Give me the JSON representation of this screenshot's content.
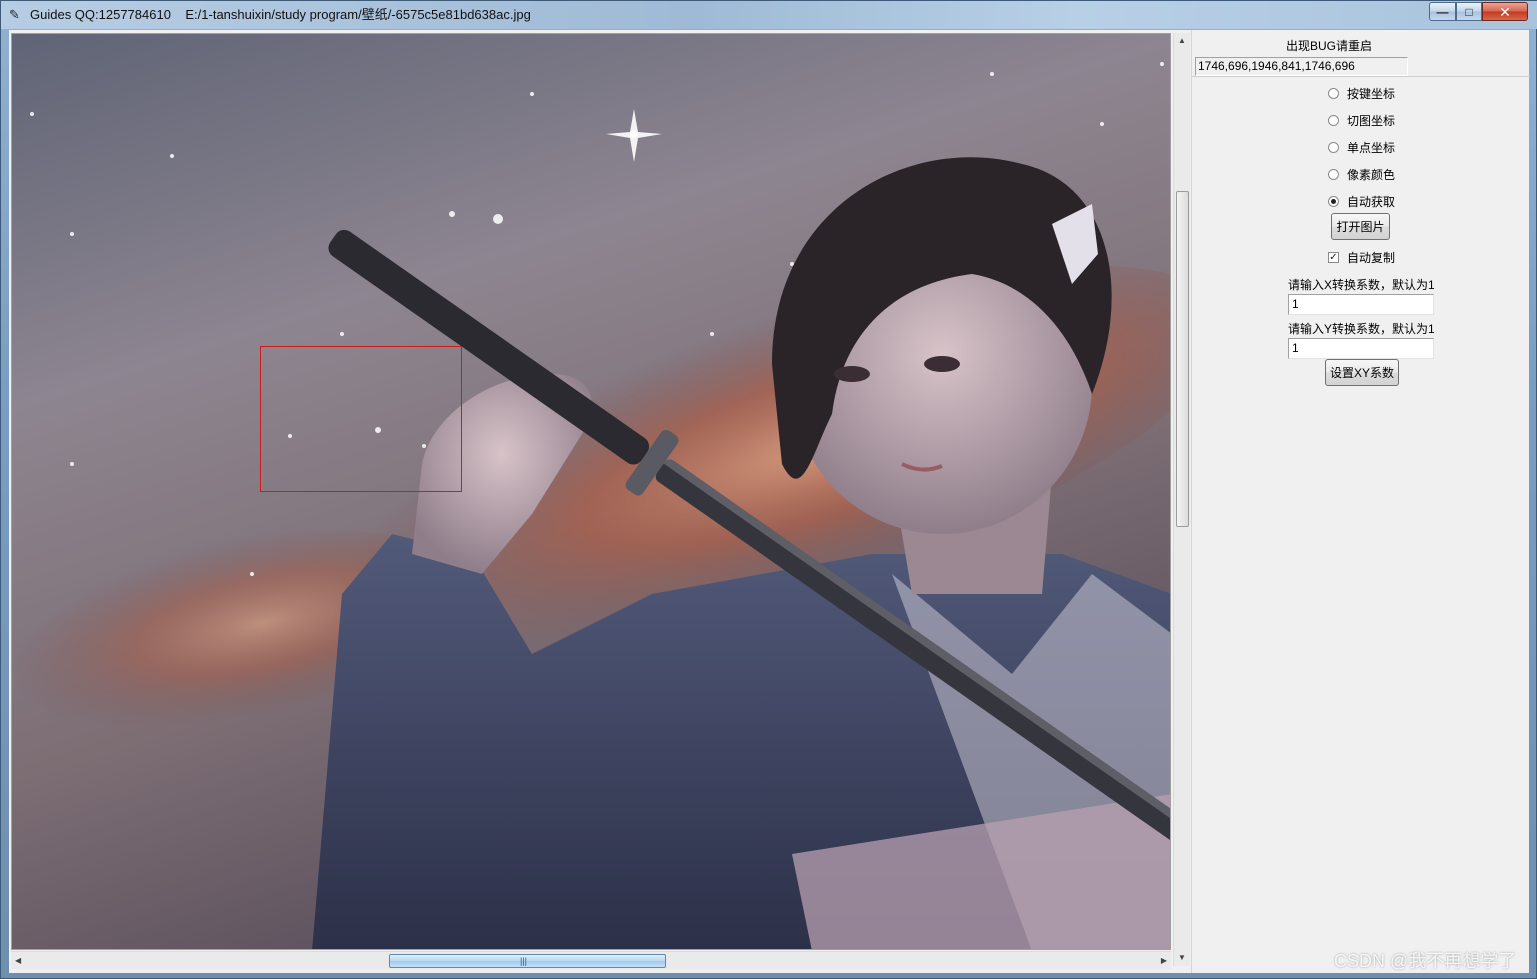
{
  "window": {
    "title": "Guides QQ:1257784610    E:/1-tanshuixin/study program/壁纸/-6575c5e81bd638ac.jpg",
    "minimize_glyph": "—",
    "maximize_glyph": "□",
    "close_glyph": "✕"
  },
  "canvas": {
    "image_description_icon": "wallpaper-image"
  },
  "scrollbars": {
    "vertical_up": "▲",
    "vertical_down": "▼",
    "vertical_grip": "≡",
    "horizontal_left": "◀",
    "horizontal_right": "▶",
    "horizontal_grip": "|||"
  },
  "panel": {
    "warning": "出现BUG请重启",
    "coords_value": "1746,696,1946,841,1746,696",
    "modes": [
      {
        "label": "按键坐标",
        "selected": false
      },
      {
        "label": "切图坐标",
        "selected": false
      },
      {
        "label": "单点坐标",
        "selected": false
      },
      {
        "label": "像素颜色",
        "selected": false
      },
      {
        "label": "自动获取",
        "selected": true
      }
    ],
    "open_image_label": "打开图片",
    "auto_copy_label": "自动复制",
    "auto_copy_checked": true,
    "x_factor_label": "请输入X转换系数，默认为1",
    "x_factor_value": "1",
    "y_factor_label": "请输入Y转换系数，默认为1",
    "y_factor_value": "1",
    "set_xy_label": "设置XY系数"
  },
  "watermark": "CSDN @我不再想学了",
  "colors": {
    "selection": "#d11a1a",
    "panel_bg": "#f0f0f0"
  }
}
